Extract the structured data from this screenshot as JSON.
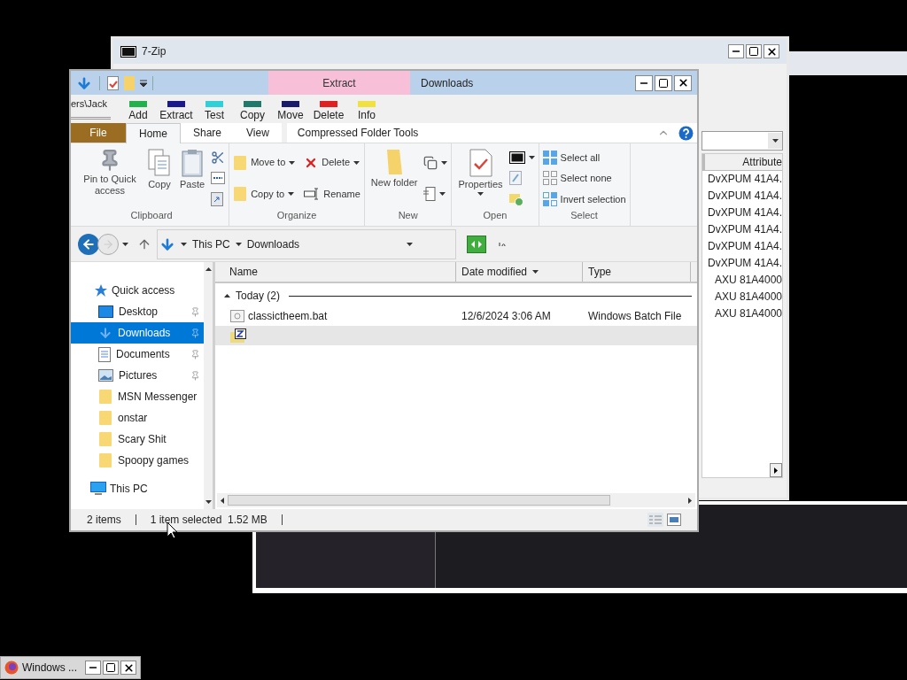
{
  "zip_window": {
    "title": "7-Zip",
    "path_fragment": "ers\\Jack",
    "toolbar": [
      "Add",
      "Extract",
      "Test",
      "Copy",
      "Move",
      "Delete",
      "Info"
    ],
    "column_header": "Attribute",
    "attributes": [
      "DvXPUM 41A4.",
      "DvXPUM 41A4.",
      "DvXPUM 41A4.",
      "DvXPUM 41A4.",
      "DvXPUM 41A4.",
      "DvXPUM 41A4.",
      "AXU 81A4000",
      "AXU 81A4000",
      "AXU 81A4000"
    ]
  },
  "explorer": {
    "title": "Downloads",
    "context_tab": "Extract",
    "ribbon_tabs": [
      {
        "label": "File",
        "kind": "file",
        "selected": false
      },
      {
        "label": "Home",
        "kind": "tab",
        "selected": true
      },
      {
        "label": "Share",
        "kind": "tab",
        "selected": false
      },
      {
        "label": "View",
        "kind": "tab",
        "selected": false
      },
      {
        "label": "Compressed Folder Tools",
        "kind": "context",
        "selected": false
      }
    ],
    "ribbon_groups": [
      {
        "label": "Clipboard",
        "kind": "clipboard",
        "items": [
          {
            "label": "Pin to Quick access",
            "kind": "large"
          },
          {
            "label": "Copy",
            "kind": "large"
          },
          {
            "label": "Paste",
            "kind": "large"
          },
          {
            "kind": "icon",
            "dropdown": false
          },
          {
            "kind": "icon",
            "dropdown": false
          },
          {
            "kind": "icon",
            "dropdown": false
          }
        ]
      },
      {
        "label": "Organize",
        "kind": "organize",
        "items": [
          {
            "label": "Move to",
            "kind": "small",
            "dropdown": true
          },
          {
            "label": "Copy to",
            "kind": "small",
            "dropdown": true
          },
          {
            "label": "Delete",
            "kind": "small",
            "dropdown": true
          },
          {
            "label": "Rename",
            "kind": "small",
            "dropdown": false
          }
        ]
      },
      {
        "label": "New",
        "kind": "new",
        "items": [
          {
            "label": "New folder",
            "kind": "large"
          },
          {
            "kind": "icon",
            "dropdown": true
          },
          {
            "kind": "icon",
            "dropdown": true
          }
        ]
      },
      {
        "label": "Open",
        "kind": "open",
        "items": [
          {
            "label": "Properties",
            "kind": "large",
            "dropdown": true
          },
          {
            "kind": "icon",
            "dropdown": true
          },
          {
            "kind": "icon",
            "dropdown": false
          },
          {
            "kind": "icon",
            "dropdown": false
          }
        ]
      },
      {
        "label": "Select",
        "kind": "select",
        "items": [
          {
            "label": "Select all",
            "kind": "small",
            "dropdown": false
          },
          {
            "label": "Select none",
            "kind": "small",
            "dropdown": false
          },
          {
            "label": "Invert selection",
            "kind": "small",
            "dropdown": false
          }
        ]
      }
    ],
    "address": [
      "This PC",
      "Downloads"
    ],
    "nav": [
      {
        "label": "Quick access",
        "kind": "quick",
        "selected": false,
        "children": [
          {
            "label": "Desktop",
            "kind": "desktop",
            "pinned": true,
            "selected": false
          },
          {
            "label": "Downloads",
            "kind": "downloads",
            "pinned": true,
            "selected": true
          },
          {
            "label": "Documents",
            "kind": "documents",
            "pinned": true,
            "selected": false
          },
          {
            "label": "Pictures",
            "kind": "pictures",
            "pinned": true,
            "selected": false
          },
          {
            "label": "MSN Messenger",
            "kind": "folder",
            "pinned": false,
            "selected": false
          },
          {
            "label": "onstar",
            "kind": "folder",
            "pinned": false,
            "selected": false
          },
          {
            "label": "Scary Shit",
            "kind": "folder",
            "pinned": false,
            "selected": false
          },
          {
            "label": "Spoopy games",
            "kind": "folder",
            "pinned": false,
            "selected": false
          }
        ]
      },
      {
        "label": "This PC",
        "kind": "pc",
        "selected": false
      }
    ],
    "columns": [
      {
        "label": "Name",
        "sorted": false
      },
      {
        "label": "Date modified",
        "sorted": true
      },
      {
        "label": "Type",
        "sorted": false
      }
    ],
    "group_label": "Today (2)",
    "files": [
      {
        "name": "classictheem.bat",
        "date": "12/6/2024 3:06 AM",
        "type": "Windows Batch File",
        "kind": "batch",
        "selected": false
      },
      {
        "kind": "zip",
        "selected": true
      }
    ],
    "status": [
      "2 items",
      "1 item selected  1.52 MB"
    ]
  },
  "taskbar": {
    "label": "Windows ..."
  }
}
